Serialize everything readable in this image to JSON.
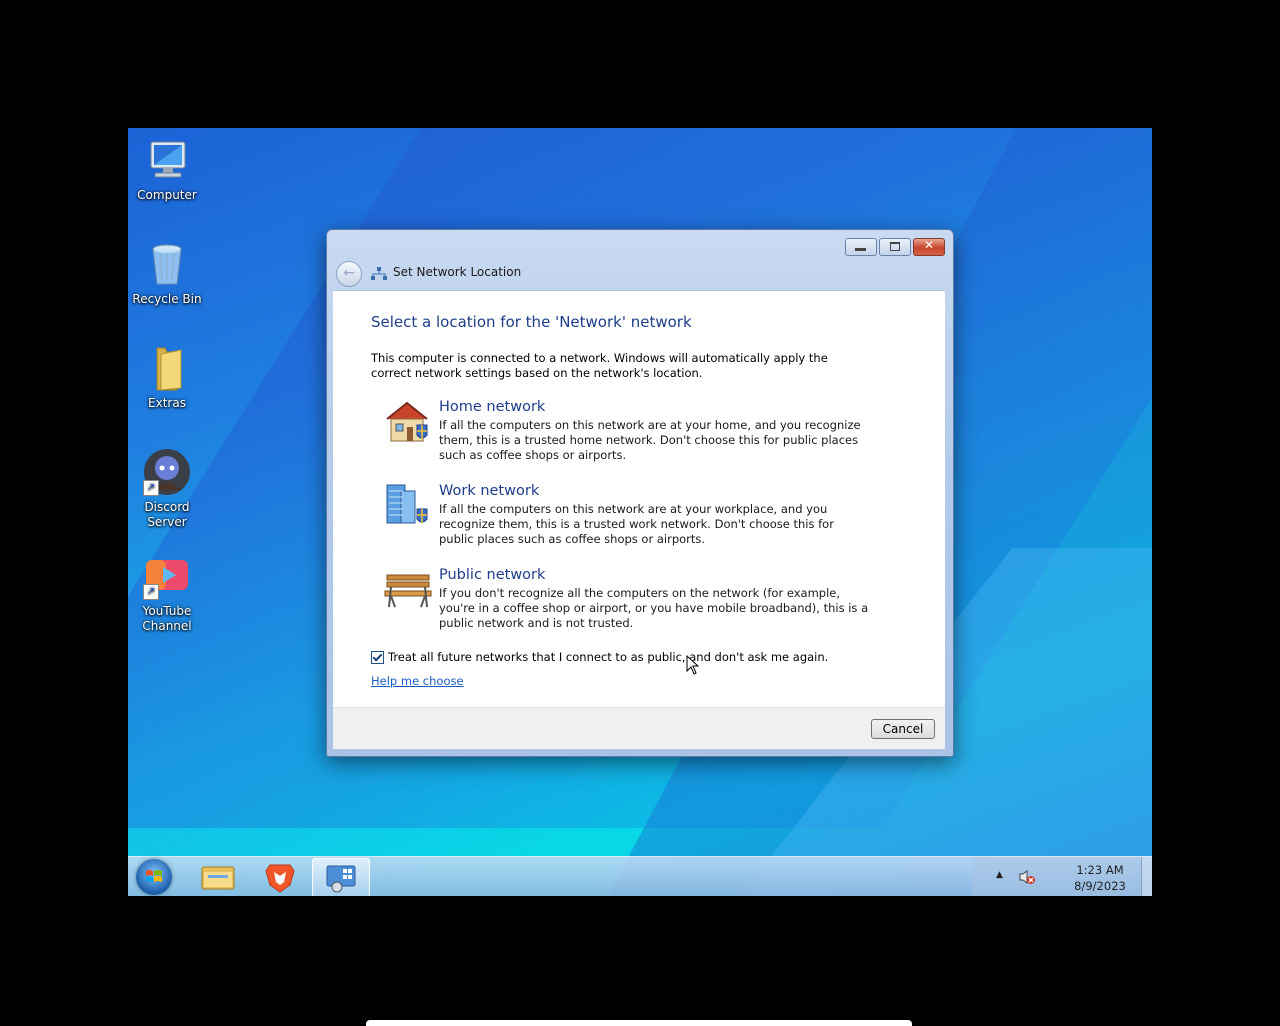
{
  "desktop": {
    "icons": [
      {
        "label": "Computer"
      },
      {
        "label": "Recycle Bin"
      },
      {
        "label": "Extras"
      },
      {
        "label": "Discord Server"
      },
      {
        "label": "YouTube Channel"
      }
    ]
  },
  "dialog": {
    "title": "Set Network Location",
    "heading": "Select a location for the 'Network' network",
    "intro": "This computer is connected to a network. Windows will automatically apply the correct network settings based on the network's location.",
    "options": [
      {
        "title": "Home network",
        "description": "If all the computers on this network are at your home, and you recognize them, this is a trusted home network.  Don't choose this for public places such as coffee shops or airports."
      },
      {
        "title": "Work network",
        "description": "If all the computers on this network are at your workplace, and you recognize them, this is a trusted work network.  Don't choose this for public places such as coffee shops or airports."
      },
      {
        "title": "Public network",
        "description": "If you don't recognize all the computers on the network (for example, you're in a coffee shop or airport, or you have mobile broadband), this is a public network and is not trusted."
      }
    ],
    "checkbox_label": "Treat all future networks that I connect to as public, and don't ask me again.",
    "checkbox_checked": true,
    "help_link": "Help me choose",
    "cancel_label": "Cancel"
  },
  "taskbar": {
    "clock_time": "1:23 AM",
    "clock_date": "8/9/2023"
  },
  "colors": {
    "heading": "#1e3d8a",
    "link": "#1a5cc5"
  }
}
